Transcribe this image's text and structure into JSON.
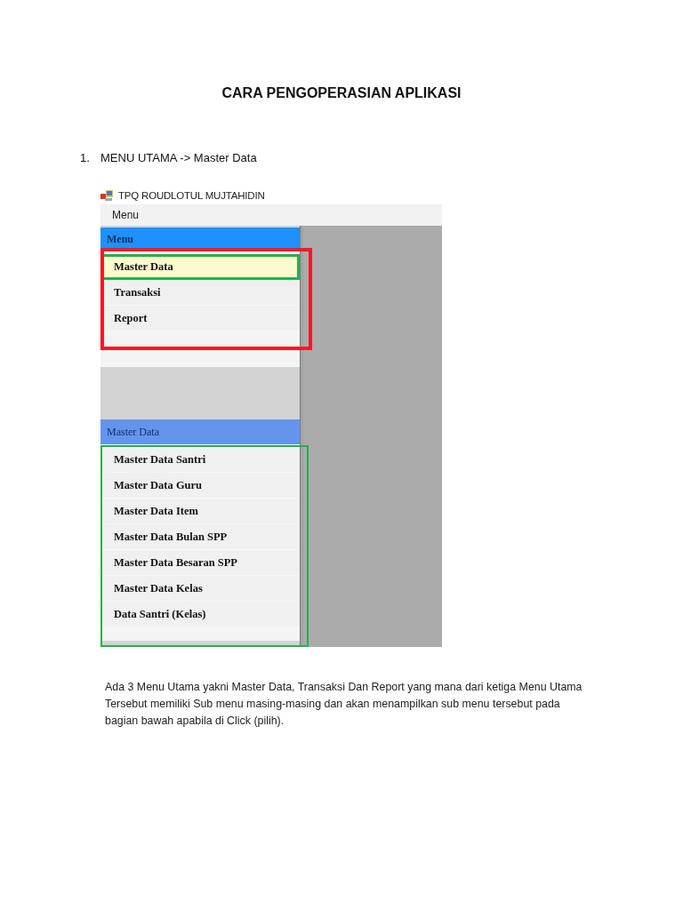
{
  "document": {
    "title": "CARA PENGOPERASIAN APLIKASI"
  },
  "steps": [
    {
      "number": "1.",
      "text": "MENU UTAMA -> Master Data"
    }
  ],
  "screenshot": {
    "window_title": "TPQ ROUDLOTUL MUJTAHIDIN",
    "menu_bar": [
      "Menu"
    ],
    "panels": [
      {
        "kind": "main",
        "header": "Menu",
        "color": "#ed1c24",
        "items": [
          {
            "label": "Master Data",
            "selected": true
          },
          {
            "label": "Transaksi",
            "selected": false
          },
          {
            "label": "Report",
            "selected": false
          }
        ]
      },
      {
        "kind": "sub",
        "header": "Master Data",
        "color": "#22b14c",
        "items": [
          {
            "label": "Master Data Santri",
            "selected": false
          },
          {
            "label": "Master Data Guru",
            "selected": false
          },
          {
            "label": "Master Data Item",
            "selected": false
          },
          {
            "label": "Master Data Bulan SPP",
            "selected": false
          },
          {
            "label": "Master Data Besaran SPP",
            "selected": false
          },
          {
            "label": "Master Data Kelas",
            "selected": false
          },
          {
            "label": "Data Santri (Kelas)",
            "selected": false
          }
        ]
      }
    ]
  },
  "description": "Ada 3 Menu Utama yakni Master Data, Transaksi Dan Report yang mana dari ketiga Menu Utama Tersebut memiliki Sub menu masing-masing dan akan menampilkan sub menu tersebut pada bagian bawah apabila di Click (pilih)."
}
